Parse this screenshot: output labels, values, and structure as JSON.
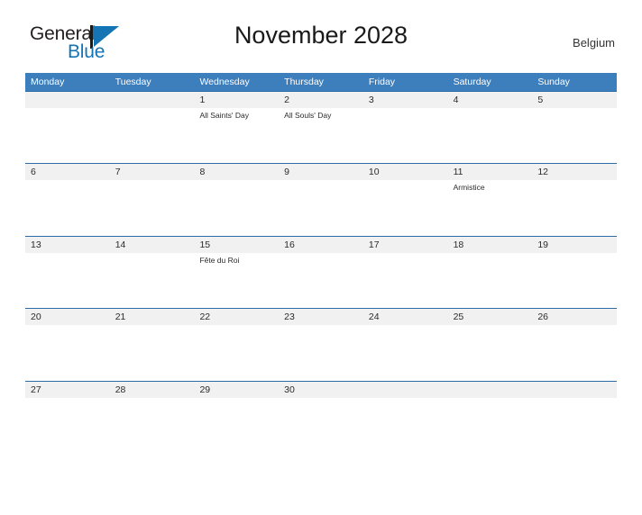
{
  "brand": {
    "name_part1": "General",
    "name_part2": "Blue",
    "logo_icon": "triangle-flag-icon",
    "accent_color": "#1474b4"
  },
  "header": {
    "title": "November 2028",
    "country": "Belgium"
  },
  "theme": {
    "header_blue": "#3d7ebd",
    "row_line_blue": "#2c6ca8",
    "row_band_gray": "#f1f1f1",
    "text_color": "#2b2b2b"
  },
  "calendar": {
    "weekdays": [
      "Monday",
      "Tuesday",
      "Wednesday",
      "Thursday",
      "Friday",
      "Saturday",
      "Sunday"
    ],
    "weeks": [
      [
        {
          "date": "",
          "event": ""
        },
        {
          "date": "",
          "event": ""
        },
        {
          "date": "1",
          "event": "All Saints' Day"
        },
        {
          "date": "2",
          "event": "All Souls' Day"
        },
        {
          "date": "3",
          "event": ""
        },
        {
          "date": "4",
          "event": ""
        },
        {
          "date": "5",
          "event": ""
        }
      ],
      [
        {
          "date": "6",
          "event": ""
        },
        {
          "date": "7",
          "event": ""
        },
        {
          "date": "8",
          "event": ""
        },
        {
          "date": "9",
          "event": ""
        },
        {
          "date": "10",
          "event": ""
        },
        {
          "date": "11",
          "event": "Armistice"
        },
        {
          "date": "12",
          "event": ""
        }
      ],
      [
        {
          "date": "13",
          "event": ""
        },
        {
          "date": "14",
          "event": ""
        },
        {
          "date": "15",
          "event": "Fête du Roi"
        },
        {
          "date": "16",
          "event": ""
        },
        {
          "date": "17",
          "event": ""
        },
        {
          "date": "18",
          "event": ""
        },
        {
          "date": "19",
          "event": ""
        }
      ],
      [
        {
          "date": "20",
          "event": ""
        },
        {
          "date": "21",
          "event": ""
        },
        {
          "date": "22",
          "event": ""
        },
        {
          "date": "23",
          "event": ""
        },
        {
          "date": "24",
          "event": ""
        },
        {
          "date": "25",
          "event": ""
        },
        {
          "date": "26",
          "event": ""
        }
      ],
      [
        {
          "date": "27",
          "event": ""
        },
        {
          "date": "28",
          "event": ""
        },
        {
          "date": "29",
          "event": ""
        },
        {
          "date": "30",
          "event": ""
        },
        {
          "date": "",
          "event": ""
        },
        {
          "date": "",
          "event": ""
        },
        {
          "date": "",
          "event": ""
        }
      ]
    ]
  }
}
